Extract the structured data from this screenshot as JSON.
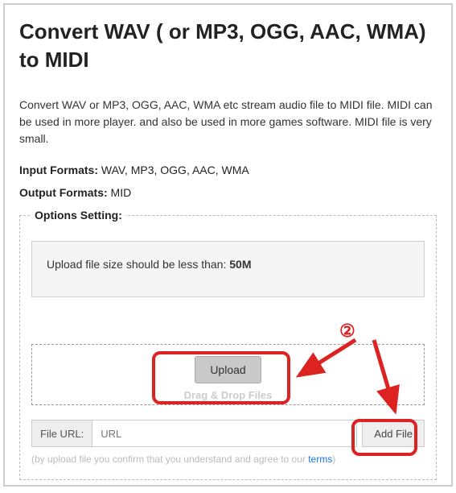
{
  "page_title": "Convert WAV ( or MP3, OGG, AAC, WMA) to MIDI",
  "description": "Convert WAV or MP3, OGG, AAC, WMA etc stream audio file to MIDI file. MIDI can be used in more player. and also be used in more games software. MIDI file is very small.",
  "input_formats": {
    "label": "Input Formats:",
    "value": "WAV, MP3, OGG, AAC, WMA"
  },
  "output_formats": {
    "label": "Output Formats:",
    "value": "MID"
  },
  "options": {
    "legend": "Options Setting:",
    "info_prefix": "Upload file size should be less than: ",
    "info_value": "50M"
  },
  "dropzone": {
    "upload_label": "Upload",
    "hint": "Drag & Drop Files"
  },
  "url_row": {
    "label": "File URL:",
    "placeholder": "URL",
    "button": "Add File"
  },
  "disclaimer": {
    "prefix": "(by upload file you confirm that you understand and agree to our ",
    "terms": "terms",
    "suffix": ")"
  },
  "annotation": {
    "step_marker": "②"
  }
}
